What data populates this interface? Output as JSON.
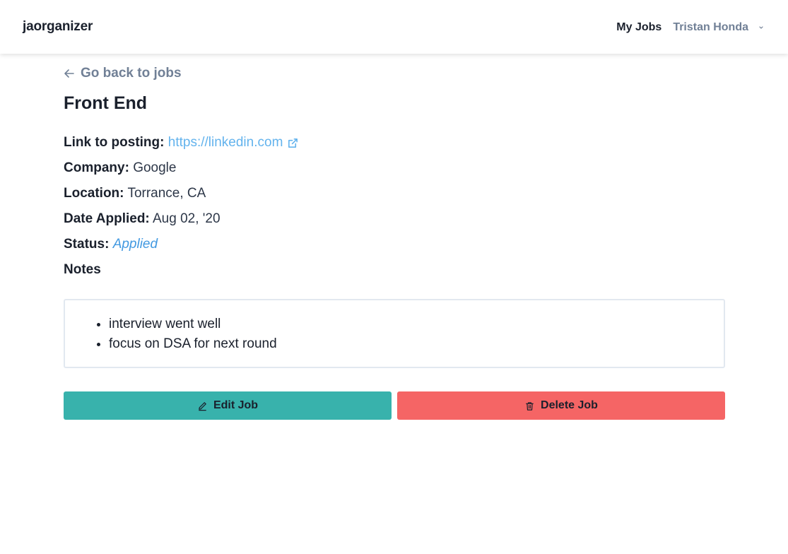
{
  "nav": {
    "brand": "jaorganizer",
    "my_jobs": "My Jobs",
    "user_name": "Tristan Honda"
  },
  "page": {
    "back_label": "Go back to jobs",
    "title": "Front End"
  },
  "fields": {
    "posting": {
      "label": "Link to posting:",
      "value": "https://linkedin.com"
    },
    "company": {
      "label": "Company:",
      "value": "Google"
    },
    "location": {
      "label": "Location:",
      "value": "Torrance, CA"
    },
    "date_applied": {
      "label": "Date Applied:",
      "value": "Aug 02, '20"
    },
    "status": {
      "label": "Status:",
      "value": "Applied"
    },
    "notes": {
      "label": "Notes"
    }
  },
  "notes": {
    "items": [
      "interview went well",
      "focus on DSA for next round"
    ]
  },
  "actions": {
    "edit_label": "Edit Job",
    "delete_label": "Delete Job"
  },
  "icons": {
    "back": "arrow-left-icon",
    "external": "external-link-icon",
    "chevron": "chevron-down-icon",
    "edit": "pencil-icon",
    "delete": "trash-icon"
  },
  "colors": {
    "edit_button": "#38b2ac",
    "delete_button": "#f56565",
    "link": "#63b3ed",
    "status": "#4299e1",
    "muted": "#718096"
  }
}
